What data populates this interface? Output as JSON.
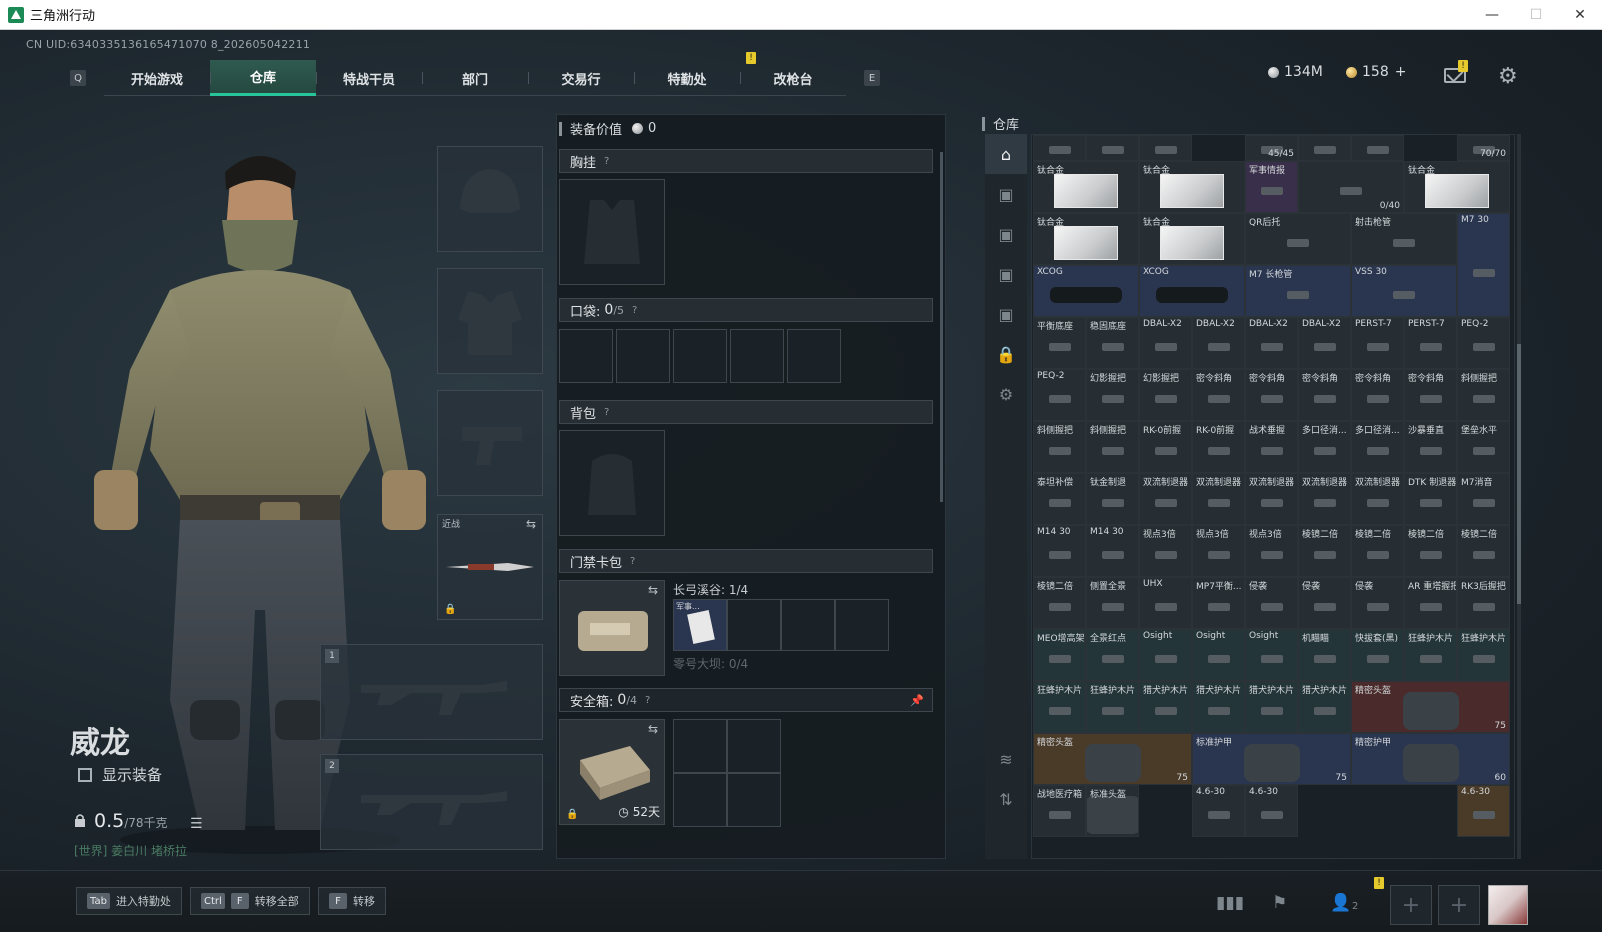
{
  "window": {
    "title": "三角洲行动",
    "controls": [
      "—",
      "☐",
      "✕"
    ]
  },
  "uid": "CN UID:6340335136165471070 8_202605042211",
  "nav": {
    "left_key": "Q",
    "right_key": "E",
    "tabs": [
      "开始游戏",
      "仓库",
      "特战干员",
      "部门",
      "交易行",
      "特勤处",
      "改枪台"
    ],
    "active_tab": "仓库",
    "badge": "!"
  },
  "currency": {
    "silver": "134M",
    "gold": "158",
    "gold_add": "+"
  },
  "operator": {
    "name": "威龙",
    "show_gear_label": "显示装备",
    "weight_value": "0.5",
    "weight_max": "/78千克",
    "location": "[世界] 姜白川  堵桥拉"
  },
  "slots": {
    "melee_label": "近战",
    "primary_num": "1",
    "secondary_num": "2"
  },
  "equipment": {
    "value_label": "装备价值",
    "value": "0",
    "chest_rig": "胸挂",
    "pockets_label": "口袋:",
    "pockets_used": "0",
    "pockets_total": "/5",
    "backpack": "背包",
    "keycard": "门禁卡包",
    "keycard_line1": "长弓溪谷: 1/4",
    "keycard_line2": "零号大坝: 0/4",
    "keycard_item_label": "军事...",
    "safebox_label": "安全箱:",
    "safebox_used": "0",
    "safebox_total": "/4",
    "safebox_days": "52天",
    "help": "?"
  },
  "warehouse": {
    "title": "仓库",
    "items": [
      {
        "name": "",
        "count": "",
        "bg": "gray"
      },
      {
        "name": "",
        "count": "",
        "bg": "gray"
      },
      {
        "name": "",
        "count": "",
        "bg": "gray"
      },
      {
        "name": "",
        "count": "45/45",
        "bg": "gray"
      },
      {
        "name": "",
        "count": "",
        "bg": "gray"
      },
      {
        "name": "",
        "count": "",
        "bg": "gray"
      },
      {
        "name": "",
        "count": "70/70",
        "bg": "gray"
      },
      {
        "name": "钛合金",
        "count": "",
        "bg": "gray"
      },
      {
        "name": "钛合金",
        "count": "",
        "bg": "gray"
      },
      {
        "name": "军事情报",
        "count": "",
        "bg": "purple"
      },
      {
        "name": "",
        "count": "0/40",
        "bg": "gray"
      },
      {
        "name": "钛合金",
        "count": "",
        "bg": "gray"
      },
      {
        "name": "钛合金",
        "count": "",
        "bg": "gray"
      },
      {
        "name": "钛合金",
        "count": "",
        "bg": "gray"
      },
      {
        "name": "QR后托",
        "count": "",
        "bg": "gray"
      },
      {
        "name": "射击枪管",
        "count": "",
        "bg": "gray"
      },
      {
        "name": "M7 30",
        "count": "",
        "bg": "blue"
      },
      {
        "name": "XCOG",
        "count": "",
        "bg": "blue"
      },
      {
        "name": "XCOG",
        "count": "",
        "bg": "blue"
      },
      {
        "name": "M7 长枪管",
        "count": "",
        "bg": "blue"
      },
      {
        "name": "VSS 30",
        "count": "",
        "bg": "blue"
      },
      {
        "name": "平衡底座",
        "count": "",
        "bg": "gray"
      },
      {
        "name": "稳固底座",
        "count": "",
        "bg": "gray"
      },
      {
        "name": "DBAL-X2",
        "count": "",
        "bg": "gray"
      },
      {
        "name": "DBAL-X2",
        "count": "",
        "bg": "gray"
      },
      {
        "name": "DBAL-X2",
        "count": "",
        "bg": "gray"
      },
      {
        "name": "DBAL-X2",
        "count": "",
        "bg": "gray"
      },
      {
        "name": "PERST-7",
        "count": "",
        "bg": "gray"
      },
      {
        "name": "PERST-7",
        "count": "",
        "bg": "gray"
      },
      {
        "name": "PEQ-2",
        "count": "",
        "bg": "gray"
      },
      {
        "name": "PEQ-2",
        "count": "",
        "bg": "gray"
      },
      {
        "name": "幻影握把",
        "count": "",
        "bg": "gray"
      },
      {
        "name": "幻影握把",
        "count": "",
        "bg": "gray"
      },
      {
        "name": "密令斜角",
        "count": "",
        "bg": "gray"
      },
      {
        "name": "密令斜角",
        "count": "",
        "bg": "gray"
      },
      {
        "name": "密令斜角",
        "count": "",
        "bg": "gray"
      },
      {
        "name": "密令斜角",
        "count": "",
        "bg": "gray"
      },
      {
        "name": "密令斜角",
        "count": "",
        "bg": "gray"
      },
      {
        "name": "斜侧握把",
        "count": "",
        "bg": "gray"
      },
      {
        "name": "斜侧握把",
        "count": "",
        "bg": "gray"
      },
      {
        "name": "斜侧握把",
        "count": "",
        "bg": "gray"
      },
      {
        "name": "RK-0前握",
        "count": "",
        "bg": "gray"
      },
      {
        "name": "RK-0前握",
        "count": "",
        "bg": "gray"
      },
      {
        "name": "战术垂握",
        "count": "",
        "bg": "gray"
      },
      {
        "name": "多口径消...",
        "count": "",
        "bg": "gray"
      },
      {
        "name": "多口径消...",
        "count": "",
        "bg": "gray"
      },
      {
        "name": "沙暴垂直",
        "count": "",
        "bg": "gray"
      },
      {
        "name": "堡垒水平",
        "count": "",
        "bg": "gray"
      },
      {
        "name": "泰坦补偿",
        "count": "",
        "bg": "gray"
      },
      {
        "name": "钛金制退",
        "count": "",
        "bg": "gray"
      },
      {
        "name": "双流制退器",
        "count": "",
        "bg": "gray"
      },
      {
        "name": "双流制退器",
        "count": "",
        "bg": "gray"
      },
      {
        "name": "双流制退器",
        "count": "",
        "bg": "gray"
      },
      {
        "name": "双流制退器",
        "count": "",
        "bg": "gray"
      },
      {
        "name": "双流制退器",
        "count": "",
        "bg": "gray"
      },
      {
        "name": "DTK 制退器",
        "count": "",
        "bg": "gray"
      },
      {
        "name": "M7消音",
        "count": "",
        "bg": "gray"
      },
      {
        "name": "M14 30",
        "count": "",
        "bg": "gray"
      },
      {
        "name": "M14 30",
        "count": "",
        "bg": "gray"
      },
      {
        "name": "视点3倍",
        "count": "",
        "bg": "gray"
      },
      {
        "name": "视点3倍",
        "count": "",
        "bg": "gray"
      },
      {
        "name": "视点3倍",
        "count": "",
        "bg": "gray"
      },
      {
        "name": "棱镜二倍",
        "count": "",
        "bg": "gray"
      },
      {
        "name": "棱镜二倍",
        "count": "",
        "bg": "gray"
      },
      {
        "name": "棱镜二倍",
        "count": "",
        "bg": "gray"
      },
      {
        "name": "棱镜二倍",
        "count": "",
        "bg": "gray"
      },
      {
        "name": "棱镜二倍",
        "count": "",
        "bg": "gray"
      },
      {
        "name": "侧置全景",
        "count": "",
        "bg": "gray"
      },
      {
        "name": "UHX",
        "count": "",
        "bg": "gray"
      },
      {
        "name": "MP7平衡...",
        "count": "",
        "bg": "gray"
      },
      {
        "name": "侵袭",
        "count": "",
        "bg": "gray"
      },
      {
        "name": "侵袭",
        "count": "",
        "bg": "gray"
      },
      {
        "name": "侵袭",
        "count": "",
        "bg": "gray"
      },
      {
        "name": "AR 重塔握把",
        "count": "",
        "bg": "gray"
      },
      {
        "name": "RK3后握把",
        "count": "",
        "bg": "gray"
      },
      {
        "name": "MEO增高架",
        "count": "",
        "bg": "green"
      },
      {
        "name": "全景红点",
        "count": "",
        "bg": "green"
      },
      {
        "name": "Osight",
        "count": "",
        "bg": "green"
      },
      {
        "name": "Osight",
        "count": "",
        "bg": "green"
      },
      {
        "name": "Osight",
        "count": "",
        "bg": "green"
      },
      {
        "name": "机瞄瞄",
        "count": "",
        "bg": "green"
      },
      {
        "name": "快拔套(黑)",
        "count": "",
        "bg": "green"
      },
      {
        "name": "狂蜂护木片",
        "count": "",
        "bg": "green"
      },
      {
        "name": "狂蜂护木片",
        "count": "",
        "bg": "green"
      },
      {
        "name": "狂蜂护木片",
        "count": "",
        "bg": "green"
      },
      {
        "name": "狂蜂护木片",
        "count": "",
        "bg": "green"
      },
      {
        "name": "猎犬护木片",
        "count": "",
        "bg": "green"
      },
      {
        "name": "猎犬护木片",
        "count": "",
        "bg": "green"
      },
      {
        "name": "猎犬护木片",
        "count": "",
        "bg": "green"
      },
      {
        "name": "猎犬护木片",
        "count": "",
        "bg": "green"
      },
      {
        "name": "精密头盔",
        "count": "75",
        "bg": "red"
      },
      {
        "name": "精密头盔",
        "count": "75",
        "bg": "gold"
      },
      {
        "name": "标准护甲",
        "count": "75",
        "bg": "blue"
      },
      {
        "name": "精密护甲",
        "count": "60",
        "bg": "blue"
      },
      {
        "name": "战地医疗箱",
        "count": "",
        "bg": "gray"
      },
      {
        "name": "标准头盔",
        "count": "",
        "bg": "gray"
      },
      {
        "name": "4.6-30",
        "count": "",
        "bg": "gray"
      },
      {
        "name": "4.6-30",
        "count": "",
        "bg": "gray"
      },
      {
        "name": "4.6-30",
        "count": "",
        "bg": "gold"
      }
    ]
  },
  "bottom": {
    "hint_tab_key": "Tab",
    "hint_tab_label": "进入特勤处",
    "hint_ctrl_key": "Ctrl",
    "hint_f_key": "F",
    "hint_transfer_all": "转移全部",
    "hint_f2_key": "F",
    "hint_transfer": "转移",
    "friends_count": "2"
  },
  "colors": {
    "accent": "#28c49a",
    "tab_active_bg": "#2f5a4f",
    "badge": "#e6c92a"
  }
}
